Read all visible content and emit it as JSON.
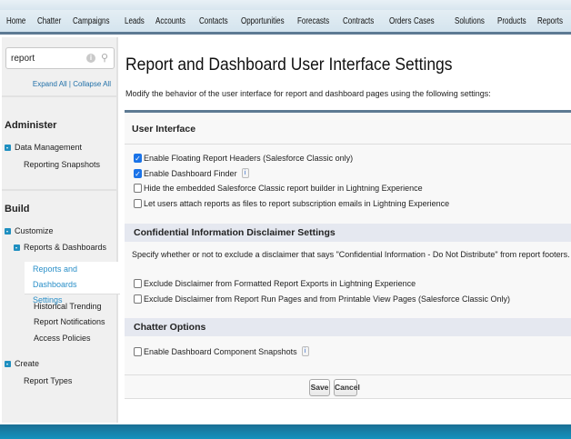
{
  "nav": {
    "tabs": [
      "Home",
      "Chatter",
      "Campaigns",
      "Leads",
      "Accounts",
      "Contacts",
      "Opportunities",
      "Forecasts",
      "Contracts",
      "Orders",
      "Cases",
      "Solutions",
      "Products",
      "Reports"
    ]
  },
  "sidebar": {
    "search_value": "report",
    "expand_all": "Expand All | Collapse All",
    "administer": "Administer",
    "data_management": "Data Management",
    "reporting_snapshots": "Reporting Snapshots",
    "build": "Build",
    "customize": "Customize",
    "reports_dashboards": "Reports & Dashboards",
    "selected_line1": "Reports and Dashboards",
    "selected_line2": "Settings",
    "historical_trending": "Historical Trending",
    "report_notifications": "Report Notifications",
    "access_policies": "Access Policies",
    "create": "Create",
    "report_types": "Report Types"
  },
  "page": {
    "title": "Report and Dashboard User Interface Settings",
    "description": "Modify the behavior of the user interface for report and dashboard pages using the following settings:"
  },
  "sections": {
    "ui": {
      "heading": "User Interface",
      "options": [
        {
          "label": "Enable Floating Report Headers (Salesforce Classic only)",
          "checked": true
        },
        {
          "label": "Enable Dashboard Finder",
          "checked": true,
          "info": "i"
        },
        {
          "label": "Hide the embedded Salesforce Classic report builder in Lightning Experience",
          "checked": false
        },
        {
          "label": "Let users attach reports as files to report subscription emails in Lightning Experience",
          "checked": false
        }
      ]
    },
    "disclaimer": {
      "heading": "Confidential Information Disclaimer Settings",
      "text": "Specify whether or not to exclude a disclaimer that says \"Confidential Information - Do Not Distribute\" from report footers.",
      "options": [
        {
          "label": "Exclude Disclaimer from Formatted Report Exports in Lightning Experience",
          "checked": false
        },
        {
          "label": "Exclude Disclaimer from Report Run Pages and from Printable View Pages (Salesforce Classic Only)",
          "checked": false
        }
      ]
    },
    "chatter": {
      "heading": "Chatter Options",
      "options": [
        {
          "label": "Enable Dashboard Component Snapshots",
          "checked": false,
          "info": "i"
        }
      ]
    }
  },
  "buttons": {
    "save": "Save",
    "cancel": "Cancel"
  }
}
